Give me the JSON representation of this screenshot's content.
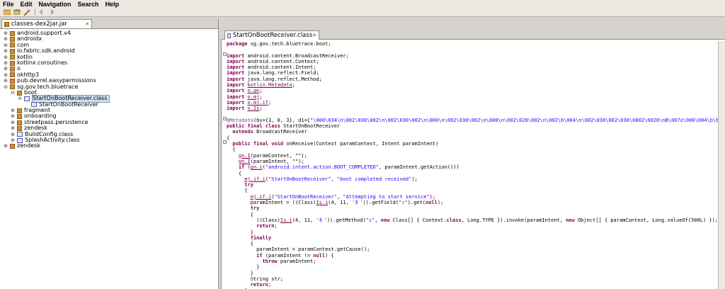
{
  "menu": [
    "File",
    "Edit",
    "Navigation",
    "Search",
    "Help"
  ],
  "toolbar": {
    "icons": [
      "folder-icon",
      "open-icon",
      "tool-icon",
      "back-icon",
      "forward-icon"
    ]
  },
  "left_tab": {
    "label": "classes-dex2jar.jar"
  },
  "tree": [
    {
      "label": "android.support.v4",
      "level": 0,
      "type": "pkg",
      "exp": "+"
    },
    {
      "label": "androidx",
      "level": 0,
      "type": "pkg",
      "exp": "+"
    },
    {
      "label": "com",
      "level": 0,
      "type": "pkg",
      "exp": "+"
    },
    {
      "label": "io.fabric.sdk.android",
      "level": 0,
      "type": "pkg",
      "exp": "+"
    },
    {
      "label": "kotlin",
      "level": 0,
      "type": "pkg",
      "exp": "+"
    },
    {
      "label": "kotlinx.coroutines",
      "level": 0,
      "type": "pkg",
      "exp": "+"
    },
    {
      "label": "o",
      "level": 0,
      "type": "pkg",
      "exp": "+"
    },
    {
      "label": "okhttp3",
      "level": 0,
      "type": "pkg",
      "exp": "+"
    },
    {
      "label": "pub.devrel.easypermissions",
      "level": 0,
      "type": "pkg",
      "exp": "+"
    },
    {
      "label": "sg.gov.tech.bluetrace",
      "level": 0,
      "type": "pkg",
      "exp": "-"
    },
    {
      "label": "boot",
      "level": 1,
      "type": "pkg",
      "exp": "-"
    },
    {
      "label": "StartOnBootReceiver.class",
      "level": 2,
      "type": "cls",
      "exp": "-",
      "selected": true
    },
    {
      "label": "StartOnBootReceiver",
      "level": 3,
      "type": "cls",
      "exp": ""
    },
    {
      "label": "fragment",
      "level": 1,
      "type": "pkg",
      "exp": "+"
    },
    {
      "label": "onboarding",
      "level": 1,
      "type": "pkg",
      "exp": "+"
    },
    {
      "label": "streetpass.persistence",
      "level": 1,
      "type": "pkg",
      "exp": "+"
    },
    {
      "label": "zendesk",
      "level": 1,
      "type": "pkg",
      "exp": "+"
    },
    {
      "label": "BuildConfig.class",
      "level": 1,
      "type": "cls",
      "exp": "+"
    },
    {
      "label": "SplashActivity.class",
      "level": 1,
      "type": "cls",
      "exp": "+"
    },
    {
      "label": "zendesk",
      "level": 0,
      "type": "pkg",
      "exp": "+"
    }
  ],
  "editor_tab": {
    "label": "StartOnBootReceiver.class"
  },
  "code": [
    [
      [
        "package ",
        "kw"
      ],
      [
        "sg.gov.tech.bluetrace.boot;",
        ""
      ]
    ],
    [
      [
        "",
        ""
      ]
    ],
    [
      [
        "import ",
        "kw"
      ],
      [
        "android.content.BroadcastReceiver;",
        ""
      ]
    ],
    [
      [
        "import ",
        "kw"
      ],
      [
        "android.content.Context;",
        ""
      ]
    ],
    [
      [
        "import ",
        "kw"
      ],
      [
        "android.content.Intent;",
        ""
      ]
    ],
    [
      [
        "import ",
        "kw"
      ],
      [
        "java.lang.reflect.Field;",
        ""
      ]
    ],
    [
      [
        "import ",
        "kw"
      ],
      [
        "java.lang.reflect.Method;",
        ""
      ]
    ],
    [
      [
        "import ",
        "kw"
      ],
      [
        "kotlin.Metadata",
        "und"
      ],
      [
        ";",
        ""
      ]
    ],
    [
      [
        "import ",
        "kw"
      ],
      [
        "o.gn",
        "und"
      ],
      [
        ";",
        ""
      ]
    ],
    [
      [
        "import ",
        "kw"
      ],
      [
        "o.mj",
        "und"
      ],
      [
        ";",
        ""
      ]
    ],
    [
      [
        "import ",
        "kw"
      ],
      [
        "o.mj.if",
        "und"
      ],
      [
        ";",
        ""
      ]
    ],
    [
      [
        "import ",
        "kw"
      ],
      [
        "o.Iş",
        "und"
      ],
      [
        ";",
        ""
      ]
    ],
    [
      [
        "",
        ""
      ]
    ],
    [
      [
        "@Metadata",
        "ann"
      ],
      [
        "(bv={1, 0, 3}, d1={",
        ""
      ],
      [
        "\"\\000\\034\\n\\002\\030\\002\\n\\002\\030\\002\\n\\000\\n\\002\\030\\002\\n\\000\\n\\002\\020\\002\\n\\002\\b\\004\\n\\002\\030\\002\\030\\0002\\0020\\nB\\007¢\\006\\004\\b\\b\\020\\tJ\\037\\02",
        "str"
      ]
    ],
    [
      [
        "public final class ",
        "kw"
      ],
      [
        "StartOnBootReceiver",
        ""
      ]
    ],
    [
      [
        "  extends ",
        "kw"
      ],
      [
        "BroadcastReceiver",
        ""
      ]
    ],
    [
      [
        "{",
        ""
      ]
    ],
    [
      [
        "  public final void ",
        "kw"
      ],
      [
        "onReceive(Context paramContext, Intent paramIntent)",
        ""
      ]
    ],
    [
      [
        "  {",
        ""
      ]
    ],
    [
      [
        "    ",
        ""
      ],
      [
        "gn.I",
        "und"
      ],
      [
        "(paramContext, ",
        ""
      ],
      [
        "\"\"",
        ""
      ],
      [
        ");",
        ""
      ]
    ],
    [
      [
        "    ",
        ""
      ],
      [
        "gn.I",
        "und"
      ],
      [
        "(paramIntent, ",
        ""
      ],
      [
        "\"\"",
        ""
      ],
      [
        ");",
        ""
      ]
    ],
    [
      [
        "    ",
        ""
      ],
      [
        "if ",
        "kw"
      ],
      [
        "(",
        ""
      ],
      [
        "gn.i",
        "und"
      ],
      [
        "(",
        ""
      ],
      [
        "\"android.intent.action.BOOT_COMPLETED\"",
        "str"
      ],
      [
        ", paramIntent.getAction()))",
        ""
      ]
    ],
    [
      [
        "    {",
        ""
      ]
    ],
    [
      [
        "      ",
        ""
      ],
      [
        "mj.if.i",
        "und"
      ],
      [
        "(",
        ""
      ],
      [
        "\"StartOnBootReceiver\"",
        "str"
      ],
      [
        ", ",
        ""
      ],
      [
        "\"boot completed received\"",
        "str"
      ],
      [
        ");",
        ""
      ]
    ],
    [
      [
        "      ",
        ""
      ],
      [
        "try",
        "kw"
      ]
    ],
    [
      [
        "      {",
        ""
      ]
    ],
    [
      [
        "        ",
        ""
      ],
      [
        "mj.if.i",
        "und"
      ],
      [
        "(",
        ""
      ],
      [
        "\"StartOnBootReceiver\"",
        "str"
      ],
      [
        ", ",
        ""
      ],
      [
        "\"Attempting to start service\"",
        "str"
      ],
      [
        ");",
        ""
      ]
    ],
    [
      [
        "        paramIntent = ((Class)",
        ""
      ],
      [
        "Iş.i",
        "und"
      ],
      [
        "(4, 11, ",
        ""
      ],
      [
        "'衤'",
        "str"
      ],
      [
        ")).getField(",
        ""
      ],
      [
        "\"ι\"",
        "str"
      ],
      [
        ").get(",
        ""
      ],
      [
        "null",
        "kw"
      ],
      [
        ");",
        ""
      ]
    ],
    [
      [
        "        ",
        ""
      ],
      [
        "try",
        "kw"
      ]
    ],
    [
      [
        "        {",
        ""
      ]
    ],
    [
      [
        "          ((Class)",
        ""
      ],
      [
        "Iş.i",
        "und"
      ],
      [
        "(4, 11, ",
        ""
      ],
      [
        "'衤'",
        "str"
      ],
      [
        ")).getMethod(",
        ""
      ],
      [
        "\"ı\"",
        "str"
      ],
      [
        ", ",
        ""
      ],
      [
        "new ",
        "kw"
      ],
      [
        "Class[] { Context.",
        ""
      ],
      [
        "class",
        "kw"
      ],
      [
        ", Long.TYPE }).invoke(paramIntent, ",
        ""
      ],
      [
        "new ",
        "kw"
      ],
      [
        "Object[] { paramContext, Long.valueOf(500L) });",
        ""
      ]
    ],
    [
      [
        "          ",
        ""
      ],
      [
        "return",
        "kw"
      ],
      [
        ";",
        ""
      ]
    ],
    [
      [
        "        }",
        ""
      ]
    ],
    [
      [
        "        ",
        ""
      ],
      [
        "finally",
        "kw"
      ]
    ],
    [
      [
        "        {",
        ""
      ]
    ],
    [
      [
        "          paramIntent = paramContext.getCause();",
        ""
      ]
    ],
    [
      [
        "          ",
        ""
      ],
      [
        "if ",
        "kw"
      ],
      [
        "(paramIntent != ",
        ""
      ],
      [
        "null",
        "kw"
      ],
      [
        ") {",
        ""
      ]
    ],
    [
      [
        "            ",
        ""
      ],
      [
        "throw ",
        "kw"
      ],
      [
        "paramIntent;",
        ""
      ]
    ],
    [
      [
        "          }",
        ""
      ]
    ],
    [
      [
        "        }",
        ""
      ]
    ],
    [
      [
        "        String str;",
        ""
      ]
    ],
    [
      [
        "        ",
        ""
      ],
      [
        "return",
        "kw"
      ],
      [
        ";",
        ""
      ]
    ],
    [
      [
        "      }",
        ""
      ]
    ]
  ]
}
